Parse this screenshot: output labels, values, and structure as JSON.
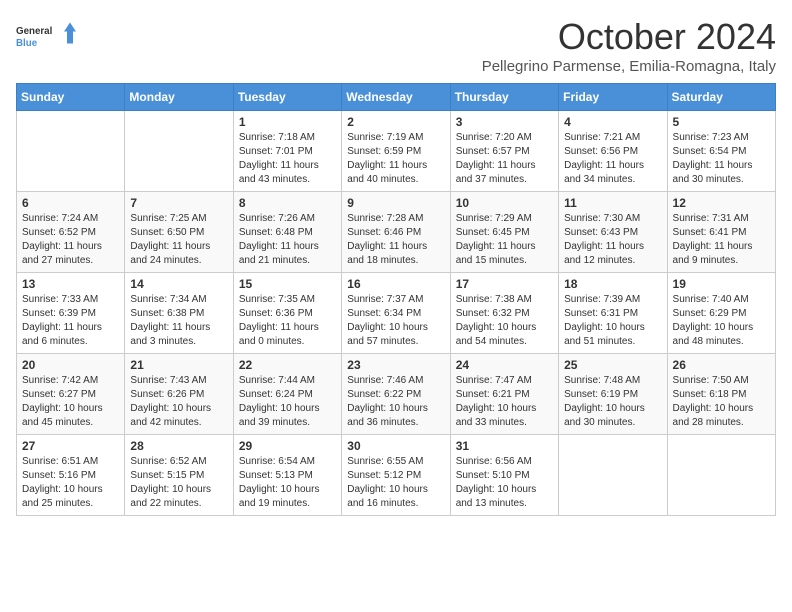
{
  "header": {
    "logo_general": "General",
    "logo_blue": "Blue",
    "month_title": "October 2024",
    "location": "Pellegrino Parmense, Emilia-Romagna, Italy"
  },
  "days_of_week": [
    "Sunday",
    "Monday",
    "Tuesday",
    "Wednesday",
    "Thursday",
    "Friday",
    "Saturday"
  ],
  "weeks": [
    [
      {
        "day": null,
        "info": null
      },
      {
        "day": null,
        "info": null
      },
      {
        "day": "1",
        "info": "Sunrise: 7:18 AM\nSunset: 7:01 PM\nDaylight: 11 hours and 43 minutes."
      },
      {
        "day": "2",
        "info": "Sunrise: 7:19 AM\nSunset: 6:59 PM\nDaylight: 11 hours and 40 minutes."
      },
      {
        "day": "3",
        "info": "Sunrise: 7:20 AM\nSunset: 6:57 PM\nDaylight: 11 hours and 37 minutes."
      },
      {
        "day": "4",
        "info": "Sunrise: 7:21 AM\nSunset: 6:56 PM\nDaylight: 11 hours and 34 minutes."
      },
      {
        "day": "5",
        "info": "Sunrise: 7:23 AM\nSunset: 6:54 PM\nDaylight: 11 hours and 30 minutes."
      }
    ],
    [
      {
        "day": "6",
        "info": "Sunrise: 7:24 AM\nSunset: 6:52 PM\nDaylight: 11 hours and 27 minutes."
      },
      {
        "day": "7",
        "info": "Sunrise: 7:25 AM\nSunset: 6:50 PM\nDaylight: 11 hours and 24 minutes."
      },
      {
        "day": "8",
        "info": "Sunrise: 7:26 AM\nSunset: 6:48 PM\nDaylight: 11 hours and 21 minutes."
      },
      {
        "day": "9",
        "info": "Sunrise: 7:28 AM\nSunset: 6:46 PM\nDaylight: 11 hours and 18 minutes."
      },
      {
        "day": "10",
        "info": "Sunrise: 7:29 AM\nSunset: 6:45 PM\nDaylight: 11 hours and 15 minutes."
      },
      {
        "day": "11",
        "info": "Sunrise: 7:30 AM\nSunset: 6:43 PM\nDaylight: 11 hours and 12 minutes."
      },
      {
        "day": "12",
        "info": "Sunrise: 7:31 AM\nSunset: 6:41 PM\nDaylight: 11 hours and 9 minutes."
      }
    ],
    [
      {
        "day": "13",
        "info": "Sunrise: 7:33 AM\nSunset: 6:39 PM\nDaylight: 11 hours and 6 minutes."
      },
      {
        "day": "14",
        "info": "Sunrise: 7:34 AM\nSunset: 6:38 PM\nDaylight: 11 hours and 3 minutes."
      },
      {
        "day": "15",
        "info": "Sunrise: 7:35 AM\nSunset: 6:36 PM\nDaylight: 11 hours and 0 minutes."
      },
      {
        "day": "16",
        "info": "Sunrise: 7:37 AM\nSunset: 6:34 PM\nDaylight: 10 hours and 57 minutes."
      },
      {
        "day": "17",
        "info": "Sunrise: 7:38 AM\nSunset: 6:32 PM\nDaylight: 10 hours and 54 minutes."
      },
      {
        "day": "18",
        "info": "Sunrise: 7:39 AM\nSunset: 6:31 PM\nDaylight: 10 hours and 51 minutes."
      },
      {
        "day": "19",
        "info": "Sunrise: 7:40 AM\nSunset: 6:29 PM\nDaylight: 10 hours and 48 minutes."
      }
    ],
    [
      {
        "day": "20",
        "info": "Sunrise: 7:42 AM\nSunset: 6:27 PM\nDaylight: 10 hours and 45 minutes."
      },
      {
        "day": "21",
        "info": "Sunrise: 7:43 AM\nSunset: 6:26 PM\nDaylight: 10 hours and 42 minutes."
      },
      {
        "day": "22",
        "info": "Sunrise: 7:44 AM\nSunset: 6:24 PM\nDaylight: 10 hours and 39 minutes."
      },
      {
        "day": "23",
        "info": "Sunrise: 7:46 AM\nSunset: 6:22 PM\nDaylight: 10 hours and 36 minutes."
      },
      {
        "day": "24",
        "info": "Sunrise: 7:47 AM\nSunset: 6:21 PM\nDaylight: 10 hours and 33 minutes."
      },
      {
        "day": "25",
        "info": "Sunrise: 7:48 AM\nSunset: 6:19 PM\nDaylight: 10 hours and 30 minutes."
      },
      {
        "day": "26",
        "info": "Sunrise: 7:50 AM\nSunset: 6:18 PM\nDaylight: 10 hours and 28 minutes."
      }
    ],
    [
      {
        "day": "27",
        "info": "Sunrise: 6:51 AM\nSunset: 5:16 PM\nDaylight: 10 hours and 25 minutes."
      },
      {
        "day": "28",
        "info": "Sunrise: 6:52 AM\nSunset: 5:15 PM\nDaylight: 10 hours and 22 minutes."
      },
      {
        "day": "29",
        "info": "Sunrise: 6:54 AM\nSunset: 5:13 PM\nDaylight: 10 hours and 19 minutes."
      },
      {
        "day": "30",
        "info": "Sunrise: 6:55 AM\nSunset: 5:12 PM\nDaylight: 10 hours and 16 minutes."
      },
      {
        "day": "31",
        "info": "Sunrise: 6:56 AM\nSunset: 5:10 PM\nDaylight: 10 hours and 13 minutes."
      },
      {
        "day": null,
        "info": null
      },
      {
        "day": null,
        "info": null
      }
    ]
  ]
}
